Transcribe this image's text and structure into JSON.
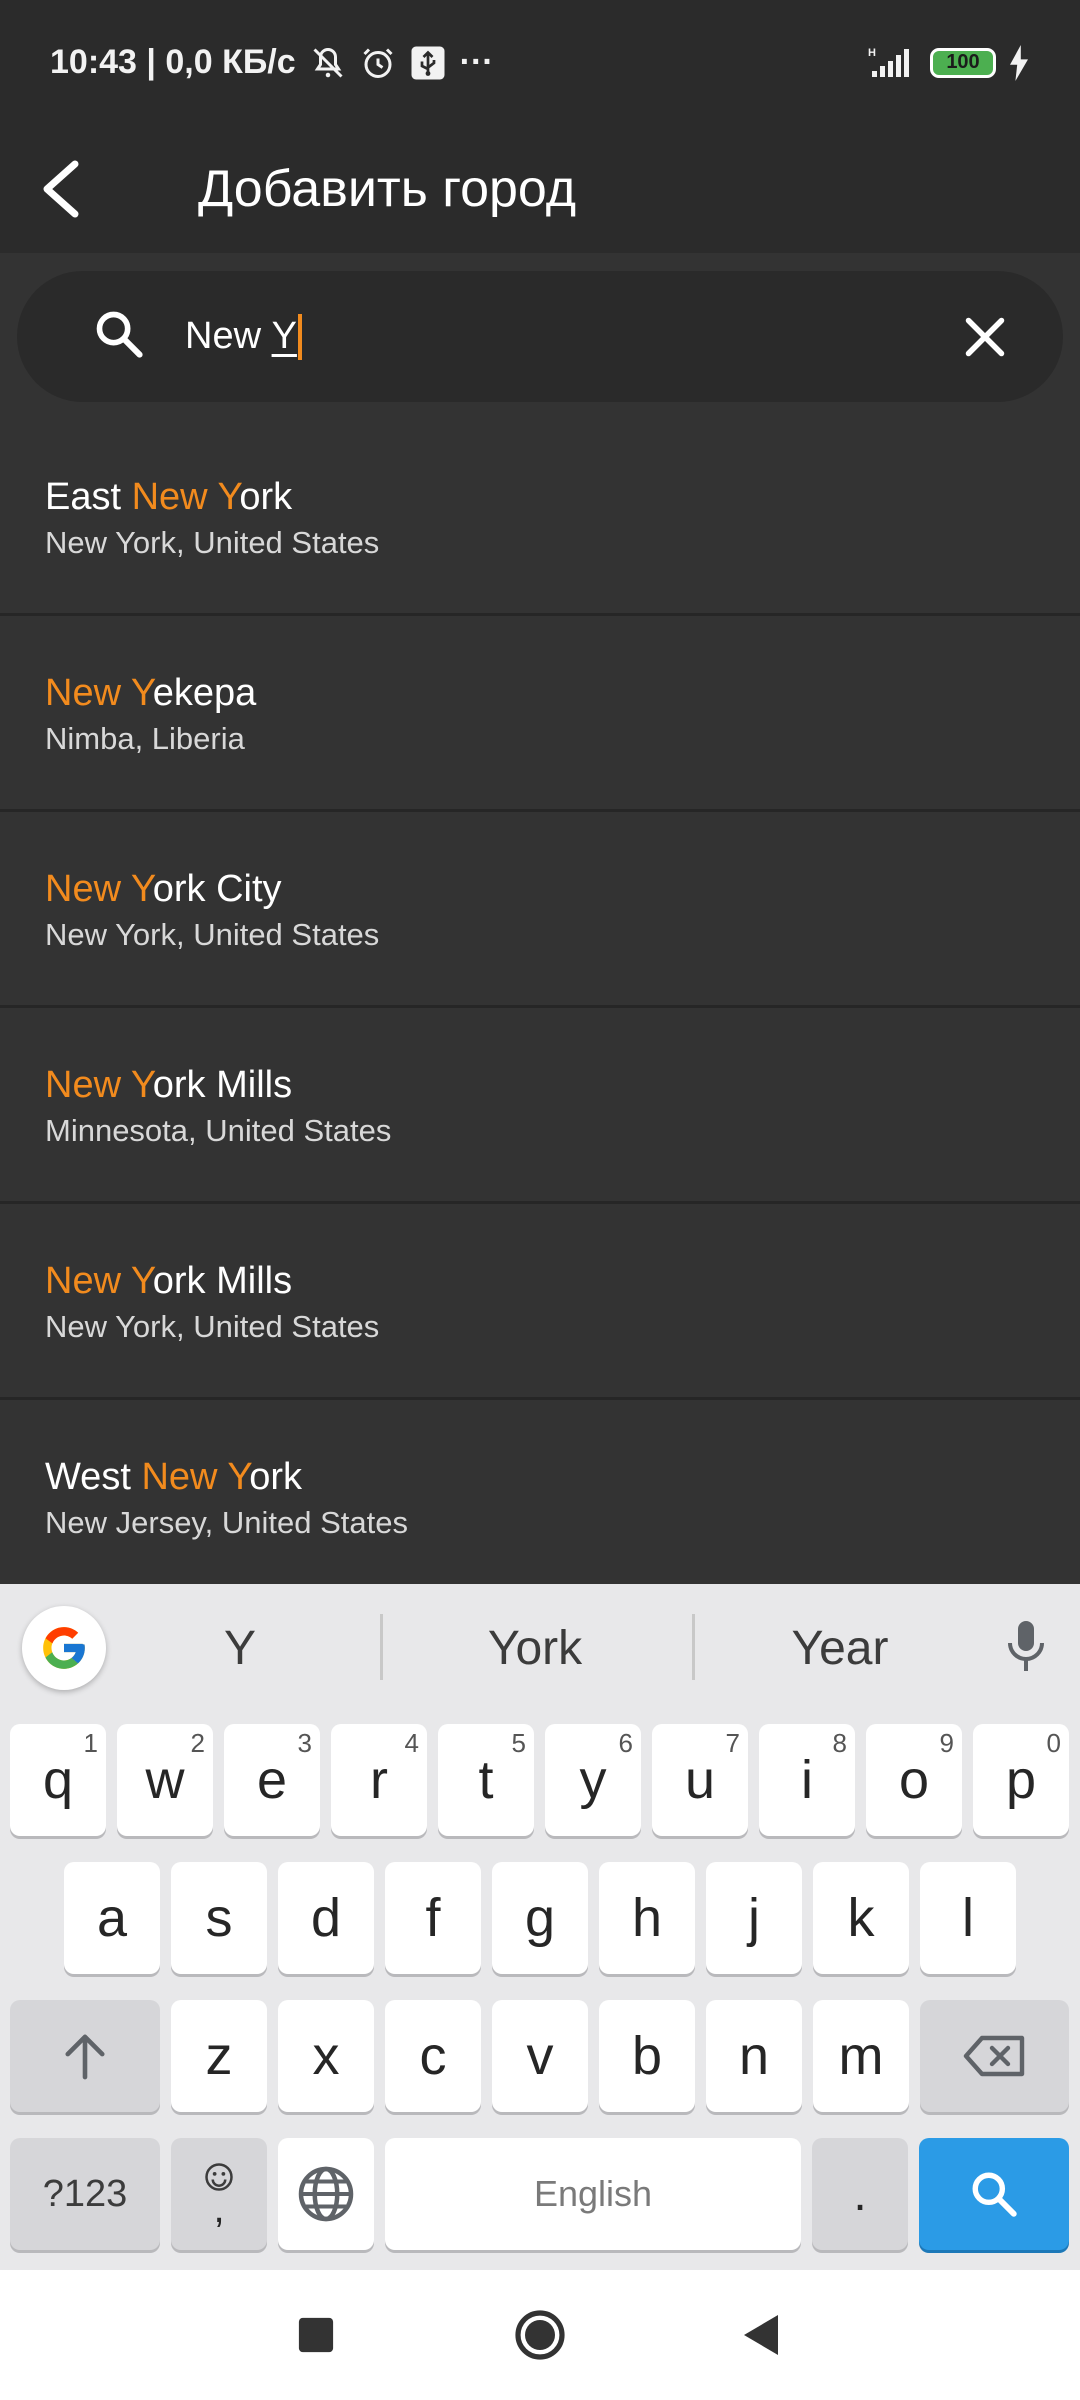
{
  "status_bar": {
    "time_speed": "10:43 | 0,0 КБ/с",
    "more": "···",
    "network": "H",
    "battery": "100",
    "icons": [
      "mute-icon",
      "alarm-icon",
      "usb-icon",
      "signal-icon",
      "battery-icon",
      "charging-icon"
    ]
  },
  "app_bar": {
    "title": "Добавить город",
    "back_icon": "arrow-back-icon"
  },
  "search": {
    "value": "New Y",
    "prefix": "New ",
    "typed": "Y",
    "search_icon": "search-icon",
    "clear_icon": "close-icon"
  },
  "results": [
    {
      "before": "East ",
      "match": "New Y",
      "after": "ork",
      "sub": "New York, United States"
    },
    {
      "before": "",
      "match": "New Y",
      "after": "ekepa",
      "sub": "Nimba, Liberia"
    },
    {
      "before": "",
      "match": "New Y",
      "after": "ork City",
      "sub": "New York, United States"
    },
    {
      "before": "",
      "match": "New Y",
      "after": "ork Mills",
      "sub": "Minnesota, United States"
    },
    {
      "before": "",
      "match": "New Y",
      "after": "ork Mills",
      "sub": "New York, United States"
    },
    {
      "before": "West ",
      "match": "New Y",
      "after": "ork",
      "sub": "New Jersey, United States"
    }
  ],
  "keyboard": {
    "suggestions": [
      "Y",
      "York",
      "Year"
    ],
    "row1": [
      "q",
      "w",
      "e",
      "r",
      "t",
      "y",
      "u",
      "i",
      "o",
      "p"
    ],
    "row1_nums": [
      "1",
      "2",
      "3",
      "4",
      "5",
      "6",
      "7",
      "8",
      "9",
      "0"
    ],
    "row2": [
      "a",
      "s",
      "d",
      "f",
      "g",
      "h",
      "j",
      "k",
      "l"
    ],
    "row3": [
      "z",
      "x",
      "c",
      "v",
      "b",
      "n",
      "m"
    ],
    "symbols_label": "?123",
    "comma": ",",
    "space_label": "English",
    "period": ".",
    "colors": {
      "accent": "#f28b1e",
      "enter": "#2b9be6"
    }
  },
  "nav_bar": {
    "icons": [
      "recents-square-icon",
      "home-circle-icon",
      "back-triangle-icon"
    ]
  }
}
